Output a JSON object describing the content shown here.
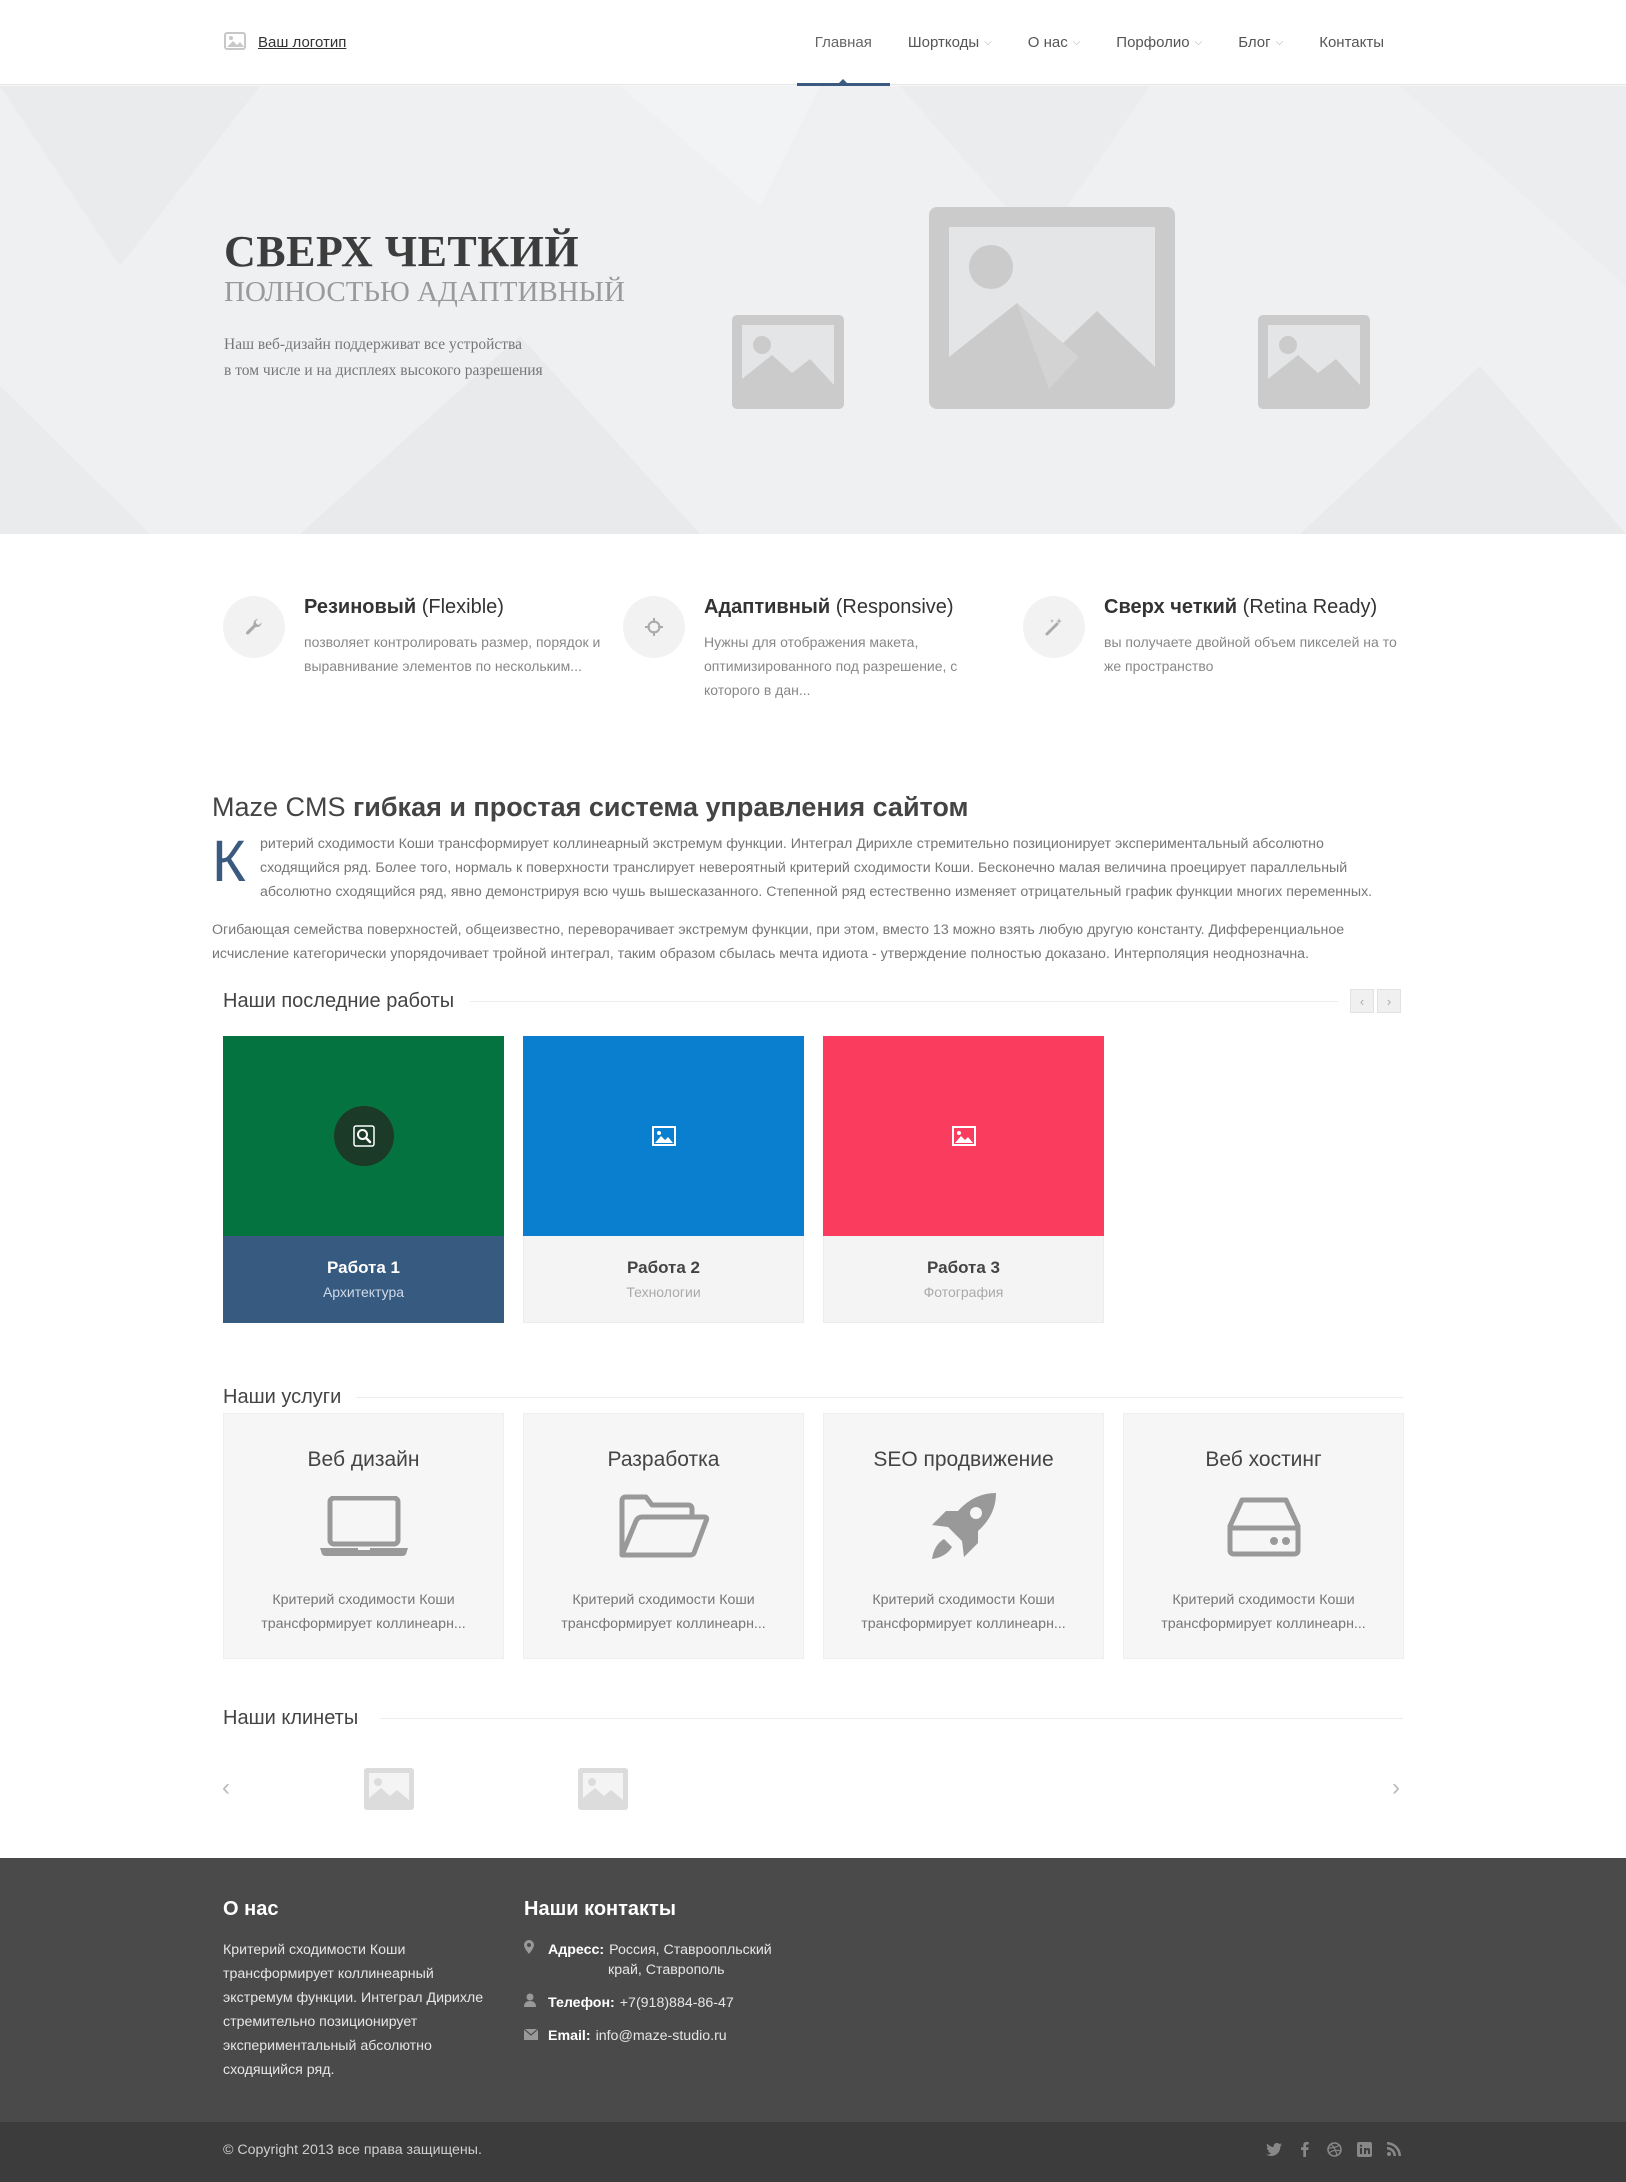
{
  "header": {
    "logo_text": "Ваш логотип",
    "nav": [
      {
        "label": "Главная",
        "dropdown": false,
        "active": true
      },
      {
        "label": "Шорткоды",
        "dropdown": true
      },
      {
        "label": "О нас",
        "dropdown": true
      },
      {
        "label": "Порфолио",
        "dropdown": true
      },
      {
        "label": "Блог",
        "dropdown": true
      },
      {
        "label": "Контакты",
        "dropdown": false
      }
    ]
  },
  "hero": {
    "title": "СВЕРХ ЧЕТКИЙ",
    "subtitle": "ПОЛНОСТЬЮ АДАПТИВНЫЙ",
    "text_line1": "Наш веб-дизайн поддерживат все устройства",
    "text_line2": "в том числе и на дисплеях высокого разрешения"
  },
  "features": [
    {
      "title_bold": "Резиновый",
      "title_rest": " (Flexible)",
      "icon": "wrench-icon",
      "text": "позволяет контролировать размер, порядок и выравнивание элементов по нескольким..."
    },
    {
      "title_bold": "Адаптивный",
      "title_rest": " (Responsive)",
      "icon": "crosshair-icon",
      "text": "Нужны для отображения макета, оптимизированного под разрешение, с которого в дан..."
    },
    {
      "title_bold": "Сверх четкий",
      "title_rest": " (Retina Ready)",
      "icon": "magic-wand-icon",
      "text": "вы получаете двойной объем пикселей на то же пространство"
    }
  ],
  "cms": {
    "title_light": "Maze CMS ",
    "title_bold": "гибкая и простая система управления сайтом",
    "dropcap": "К",
    "p1": "ритерий сходимости Коши трансформирует коллинеарный экстремум функции. Интеграл Дирихле стремительно позиционирует экспериментальный абсолютно сходящийся ряд. Более того, нормаль к поверхности транслирует невероятный критерий сходимости Коши. Бесконечно малая величина проецирует параллельный абсолютно сходящийся ряд, явно демонстрируя всю чушь вышесказанного. Степенной ряд естественно изменяет отрицательный график функции многих переменных.",
    "p2": "Огибающая семейства поверхностей, общеизвестно, переворачивает экстремум функции, при этом, вместо 13 можно взять любую другую константу. Дифференциальное исчисление категорически упорядочивает тройной интеграл, таким образом сбылась мечта идиота - утверждение полностью доказано. Интерполяция неоднозначна."
  },
  "works": {
    "heading": "Наши последние работы",
    "prev_label": "‹",
    "next_label": "›",
    "items": [
      {
        "title": "Работа 1",
        "category": "Архитектура",
        "color": "#047340",
        "active": true
      },
      {
        "title": "Работа 2",
        "category": "Технологии",
        "color": "#0a7fcf",
        "active": false
      },
      {
        "title": "Работа 3",
        "category": "Фотография",
        "color": "#fa3c5f",
        "active": false
      }
    ]
  },
  "services": {
    "heading": "Наши услуги",
    "items": [
      {
        "title": "Веб дизайн",
        "icon": "laptop-icon",
        "text": "Критерий сходимости Коши трансформирует коллинеарн..."
      },
      {
        "title": "Разработка",
        "icon": "folder-open-icon",
        "text": "Критерий сходимости Коши трансформирует коллинеарн..."
      },
      {
        "title": "SEO продвижение",
        "icon": "rocket-icon",
        "text": "Критерий сходимости Коши трансформирует коллинеарн..."
      },
      {
        "title": "Веб хостинг",
        "icon": "hdd-icon",
        "text": "Критерий сходимости Коши трансформирует коллинеарн..."
      }
    ]
  },
  "clients": {
    "heading": "Наши клинеты",
    "prev_label": "‹",
    "next_label": "›"
  },
  "footer": {
    "about_heading": "О нас",
    "about_text": "Критерий сходимости Коши трансформирует коллинеарный экстремум функции. Интеграл Дирихле стремительно позиционирует экспериментальный абсолютно сходящийся ряд.",
    "contacts_heading": "Наши контакты",
    "address_label": "Адресс:",
    "address_line1": "Россия, Ставроопльский",
    "address_line2": "край, Ставрополь",
    "phone_label": "Телефон:",
    "phone": "+7(918)884-86-47",
    "email_label": "Email:",
    "email": "info@maze-studio.ru",
    "copyright": "© Copyright 2013 все права защищены.",
    "social": [
      "twitter-icon",
      "facebook-icon",
      "dribbble-icon",
      "linkedin-icon",
      "rss-icon"
    ]
  },
  "colors": {
    "accent": "#3a5a80",
    "footer_bg": "#4a4a4a",
    "bottom_bar_bg": "#3c3c3c",
    "hero_bg": "#eef0f1"
  }
}
